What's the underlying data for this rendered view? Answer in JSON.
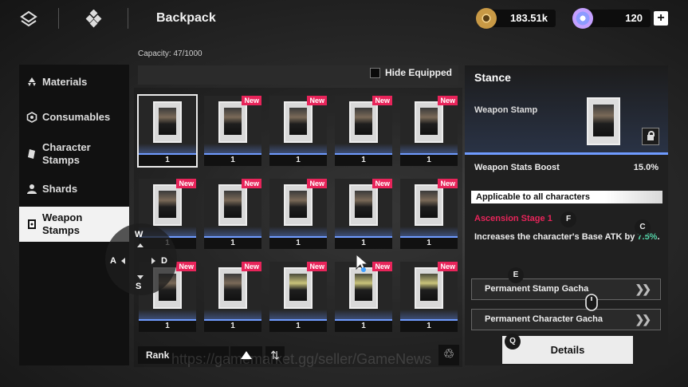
{
  "header": {
    "title": "Backpack",
    "currencies": [
      {
        "name": "gold-coin",
        "amount": "183.51k"
      },
      {
        "name": "crystal",
        "amount": "120"
      }
    ],
    "plus_label": "+"
  },
  "capacity": "Capacity: 47/1000",
  "sidebar": {
    "items": [
      {
        "label": "Materials",
        "icon": "materials-icon",
        "active": false
      },
      {
        "label": "Consumables",
        "icon": "consumables-icon",
        "active": false
      },
      {
        "label": "Character\nStamps",
        "icon": "character-stamps-icon",
        "active": false
      },
      {
        "label": "Shards",
        "icon": "shards-icon",
        "active": false
      },
      {
        "label": "Weapon\nStamps",
        "icon": "weapon-stamps-icon",
        "active": true
      }
    ]
  },
  "filter": {
    "hide_equipped_label": "Hide Equipped",
    "hide_equipped_checked": false
  },
  "grid": {
    "new_badge": "New",
    "items": [
      {
        "count": "1",
        "new": false,
        "selected": true,
        "variant": false
      },
      {
        "count": "1",
        "new": true,
        "selected": false,
        "variant": false
      },
      {
        "count": "1",
        "new": true,
        "selected": false,
        "variant": false
      },
      {
        "count": "1",
        "new": true,
        "selected": false,
        "variant": false
      },
      {
        "count": "1",
        "new": true,
        "selected": false,
        "variant": false
      },
      {
        "count": "1",
        "new": true,
        "selected": false,
        "variant": false
      },
      {
        "count": "1",
        "new": true,
        "selected": false,
        "variant": false
      },
      {
        "count": "1",
        "new": true,
        "selected": false,
        "variant": false
      },
      {
        "count": "1",
        "new": true,
        "selected": false,
        "variant": false
      },
      {
        "count": "1",
        "new": true,
        "selected": false,
        "variant": false
      },
      {
        "count": "1",
        "new": true,
        "selected": false,
        "variant": false
      },
      {
        "count": "1",
        "new": true,
        "selected": false,
        "variant": false
      },
      {
        "count": "1",
        "new": true,
        "selected": false,
        "variant": true
      },
      {
        "count": "1",
        "new": true,
        "selected": false,
        "variant": true
      },
      {
        "count": "1",
        "new": true,
        "selected": false,
        "variant": true
      }
    ]
  },
  "sort": {
    "label": "Rank"
  },
  "watermark": "https://gamemarket.gg/seller/GameNews",
  "detail": {
    "title": "Stance",
    "subtitle": "Weapon Stamp",
    "stat_name": "Weapon Stats Boost",
    "stat_value": "15.0%",
    "applicable": "Applicable to all characters",
    "ascension": "Ascension Stage 1",
    "desc_main": "Increases the character's Base ATK by ",
    "desc_pct": "7.5%",
    "desc_end": ".",
    "gacha_buttons": [
      "Permanent Stamp Gacha",
      "Permanent Character Gacha"
    ],
    "details_label": "Details"
  },
  "hints": {
    "w": "W",
    "a": "A",
    "s": "S",
    "d": "D",
    "f": "F",
    "c": "C",
    "e": "E",
    "q": "Q"
  },
  "colors": {
    "accent_new": "#e8245a",
    "accent_blue": "#6f9bff",
    "accent_green": "#54d4a8"
  }
}
